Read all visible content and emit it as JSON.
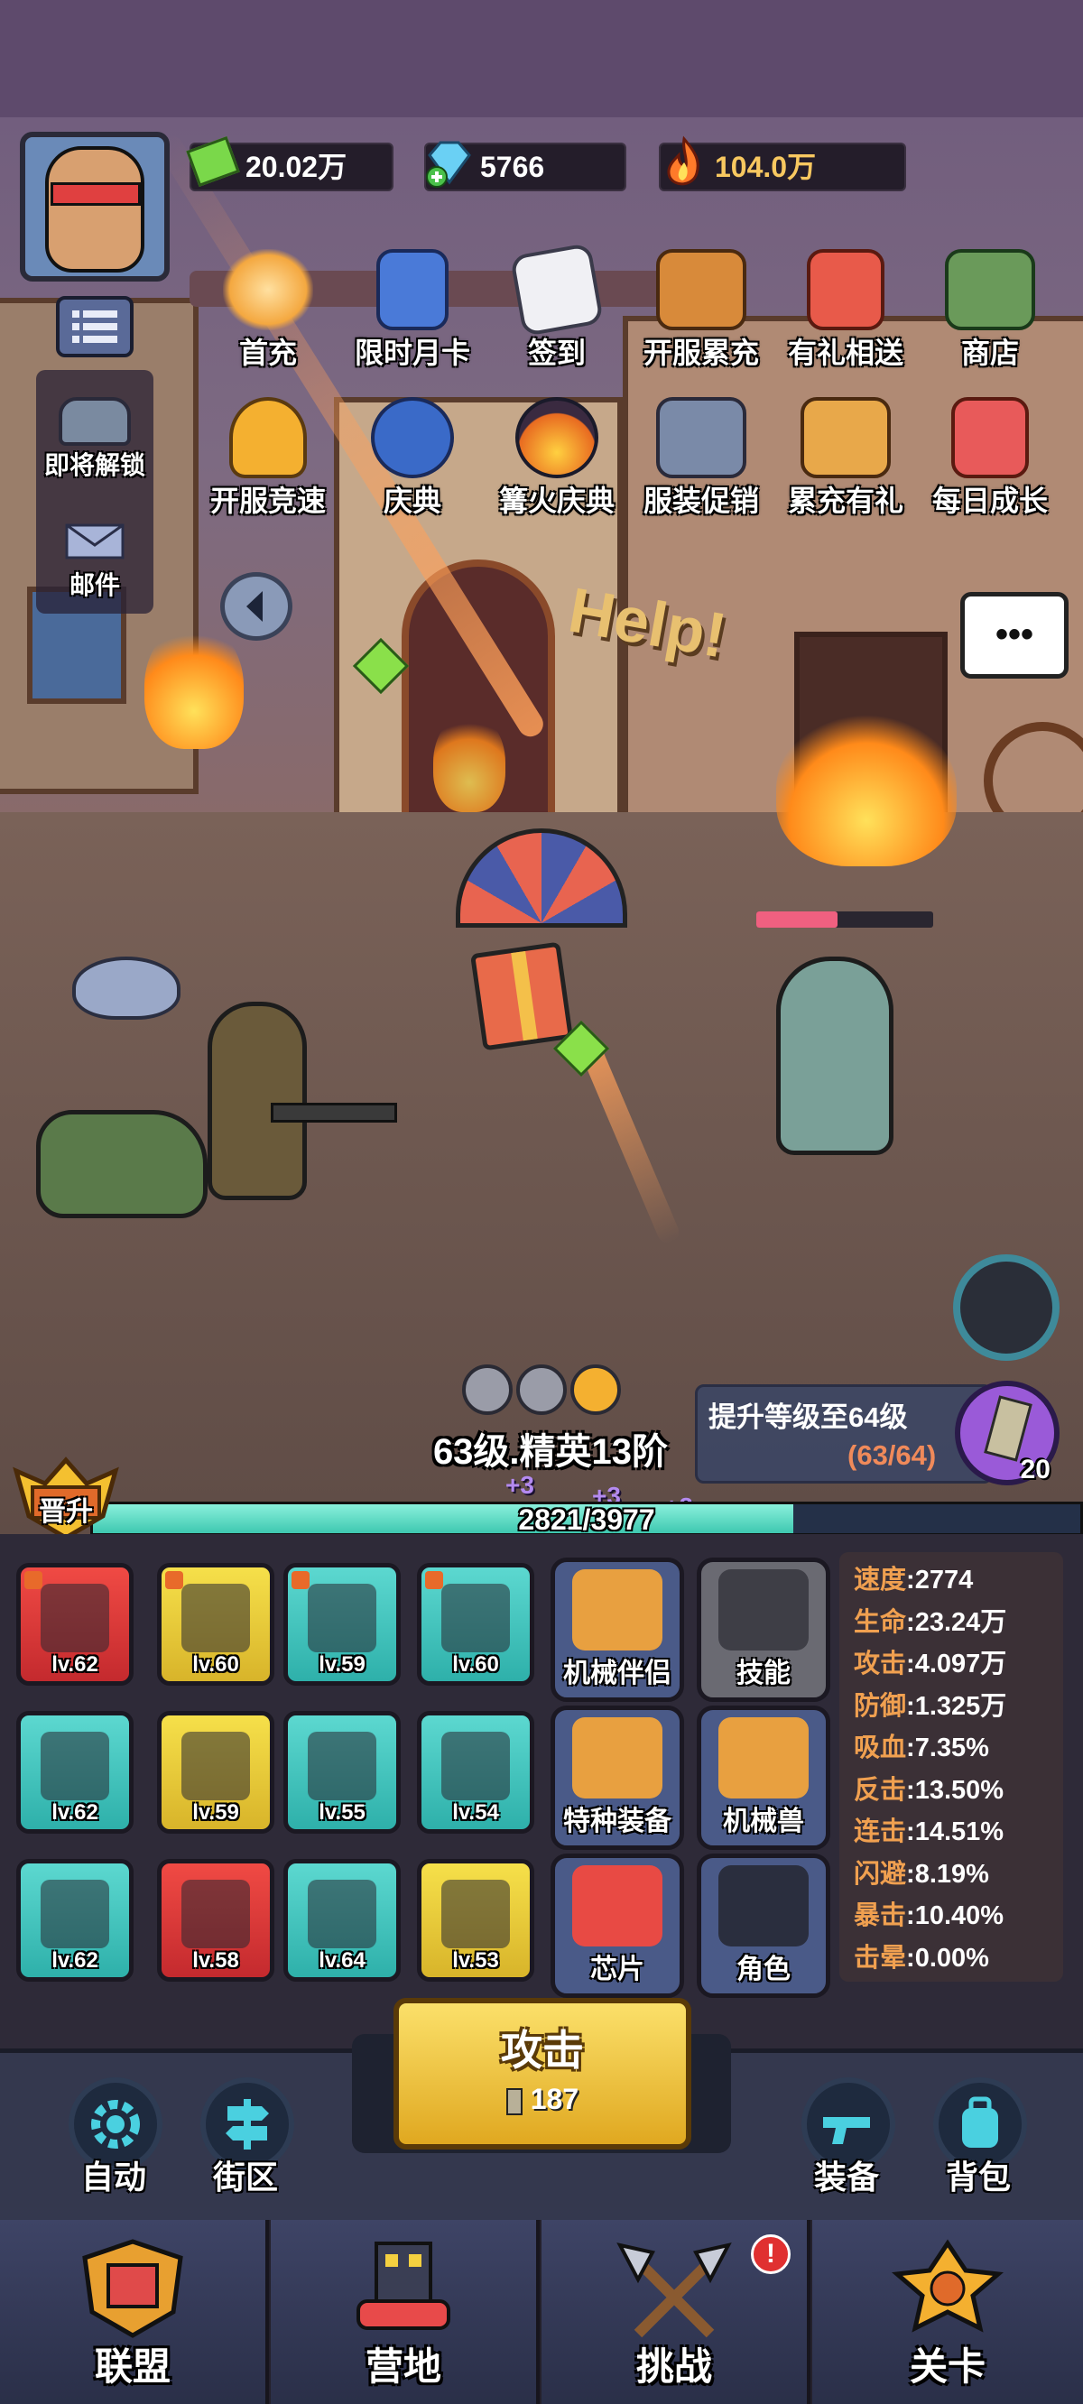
{
  "resources": {
    "cash": "20.02万",
    "diamonds": "5766",
    "power": "104.0万"
  },
  "top_icons_row1": [
    {
      "label": "首充"
    },
    {
      "label": "限时月卡"
    },
    {
      "label": "签到"
    },
    {
      "label": "开服累充"
    },
    {
      "label": "有礼相送"
    },
    {
      "label": "商店"
    }
  ],
  "top_icons_row2": [
    {
      "label": "开服竞速"
    },
    {
      "label": "庆典"
    },
    {
      "label": "篝火庆典"
    },
    {
      "label": "服装促销"
    },
    {
      "label": "累充有礼"
    },
    {
      "label": "每日成长"
    }
  ],
  "side": {
    "unlock_label": "即将解锁",
    "mail_label": "邮件"
  },
  "scene": {
    "help_text": "Help!",
    "chat_dots": "•••"
  },
  "player": {
    "level_text": "63级.精英13阶",
    "promote_label": "晋升",
    "xp_text": "2821/3977",
    "xp_fraction": 0.709,
    "bonus1": "+3",
    "bonus2": "+3",
    "bonus3": "+2"
  },
  "upgrade": {
    "text": "提升等级至64级",
    "progress": "(63/64)",
    "count": "20"
  },
  "equipment": [
    {
      "lv": "lv.62",
      "color": "red"
    },
    {
      "lv": "lv.60",
      "color": "yel"
    },
    {
      "lv": "lv.59",
      "color": "cyan"
    },
    {
      "lv": "lv.60",
      "color": "cyan"
    },
    {
      "lv": "lv.62",
      "color": "cyan"
    },
    {
      "lv": "lv.59",
      "color": "yel"
    },
    {
      "lv": "lv.55",
      "color": "cyan"
    },
    {
      "lv": "lv.54",
      "color": "cyan"
    },
    {
      "lv": "lv.62",
      "color": "cyan"
    },
    {
      "lv": "lv.58",
      "color": "red"
    },
    {
      "lv": "lv.64",
      "color": "cyan"
    },
    {
      "lv": "lv.53",
      "color": "yel"
    }
  ],
  "functions": {
    "mech_partner": "机械伴侣",
    "skills": "技能",
    "special_gear": "特种装备",
    "mech_beast": "机械兽",
    "chip": "芯片",
    "character": "角色"
  },
  "stats": [
    {
      "k": "速度",
      "v": "2774"
    },
    {
      "k": "生命",
      "v": "23.24万"
    },
    {
      "k": "攻击",
      "v": "4.097万"
    },
    {
      "k": "防御",
      "v": "1.325万"
    },
    {
      "k": "吸血",
      "v": "7.35%"
    },
    {
      "k": "反击",
      "v": "13.50%"
    },
    {
      "k": "连击",
      "v": "14.51%"
    },
    {
      "k": "闪避",
      "v": "8.19%"
    },
    {
      "k": "暴击",
      "v": "10.40%"
    },
    {
      "k": "击晕",
      "v": "0.00%"
    }
  ],
  "attack": {
    "label": "攻击",
    "ammo": "187"
  },
  "controls": {
    "auto": "自动",
    "district": "街区",
    "equip": "装备",
    "bag": "背包"
  },
  "nav": {
    "alliance": "联盟",
    "camp": "营地",
    "challenge": "挑战",
    "stage": "关卡",
    "alert": "!"
  },
  "colors": {
    "xp_bar": "#5fe0c8",
    "enemy_hp": "#f06080",
    "attack_button": "#f2c43a"
  }
}
